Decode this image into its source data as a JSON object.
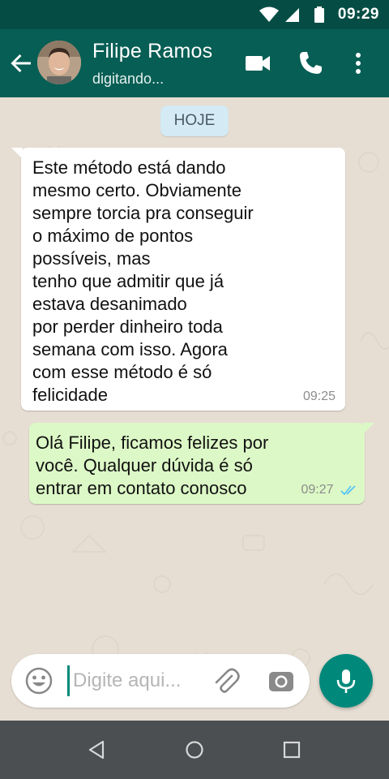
{
  "status_bar": {
    "time": "09:29",
    "icons": [
      "wifi-icon",
      "signal-icon",
      "battery-icon"
    ]
  },
  "header": {
    "contact_name": "Filipe Ramos",
    "contact_status": "digitando...",
    "actions": [
      "video-call-icon",
      "phone-icon",
      "more-options-icon"
    ]
  },
  "chat": {
    "date_label": "HOJE",
    "messages": [
      {
        "direction": "incoming",
        "text": "Este método está dando\nmesmo certo. Obviamente\nsempre torcia pra conseguir\no máximo de pontos\npossíveis, mas\ntenho que admitir que já\nestava desanimado\npor perder dinheiro toda\nsemana com isso. Agora\ncom esse método é só\nfelicidade",
        "time": "09:25"
      },
      {
        "direction": "outgoing",
        "text": "Olá Filipe, ficamos felizes por\nvocê. Qualquer dúvida é só\nentrar em contato conosco",
        "time": "09:27",
        "status": "read"
      }
    ]
  },
  "composer": {
    "placeholder": "Digite aqui...",
    "value": ""
  },
  "colors": {
    "app_bar": "#075e54",
    "status_bar": "#054d44",
    "accent": "#00897b",
    "outgoing_bubble": "#dcf8c6",
    "read_ticks": "#4fc3f7",
    "chat_background": "#e6ded3"
  }
}
